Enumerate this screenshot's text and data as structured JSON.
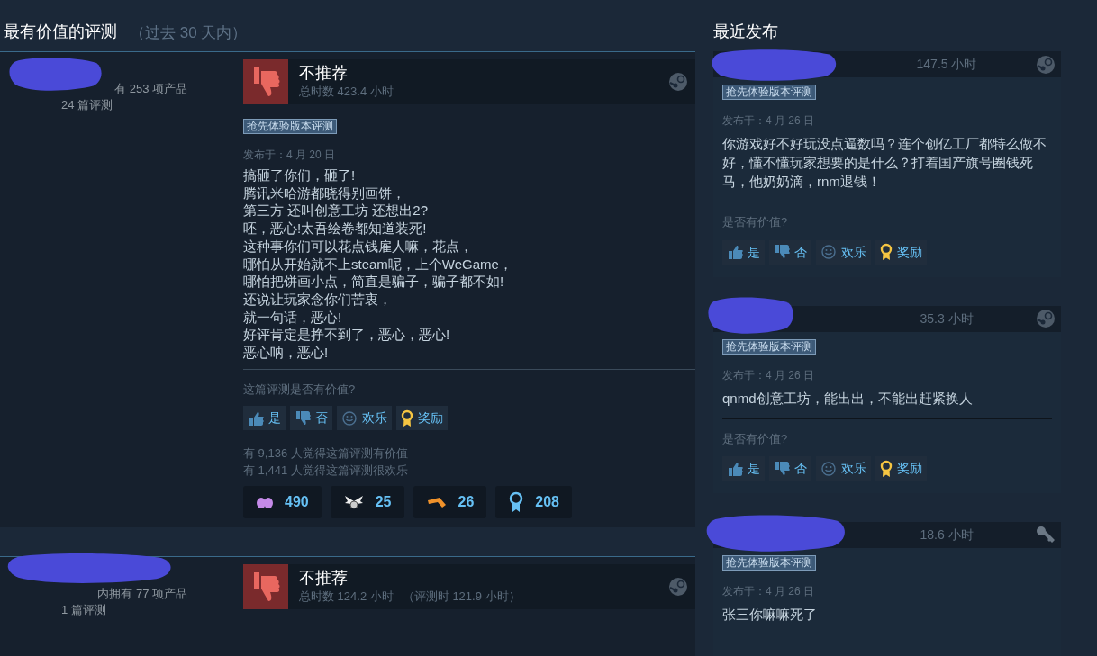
{
  "helpful_section": {
    "title": "最有价值的评测",
    "subtitle": "（过去 30 天内）"
  },
  "helpful_reviews": [
    {
      "author": {
        "products": "有 253 项产品",
        "reviews": "24 篇评测"
      },
      "recommended": false,
      "verdict": "不推荐",
      "hours": "总时数 423.4 小时",
      "kind": "steam",
      "badge": "抢先体验版本评测",
      "posted": "发布于：4 月 20 日",
      "body_lines": [
        "搞砸了你们，砸了!",
        "腾讯米哈游都晓得别画饼，",
        "第三方 还叫创意工坊 还想出2?",
        "呸，恶心!太吾绘卷都知道装死!",
        "这种事你们可以花点钱雇人嘛，花点，",
        "哪怕从开始就不上steam呢，上个WeGame，",
        "哪怕把饼画小点，简直是骗子，骗子都不如!",
        "还说让玩家念你们苦衷，",
        "就一句话，恶心!",
        "好评肯定是挣不到了，恶心，恶心!",
        "恶心呐，恶心!"
      ],
      "question": "这篇评测是否有价值?",
      "buttons": [
        {
          "kind": "yes",
          "label": "是"
        },
        {
          "kind": "no",
          "label": "否"
        },
        {
          "kind": "funny",
          "label": "欢乐"
        },
        {
          "kind": "award",
          "label": "奖励"
        }
      ],
      "stats": [
        "有 9,136 人觉得这篇评测有价值",
        "有 1,441 人觉得这篇评测很欢乐"
      ],
      "awards": [
        {
          "kind": "hearts",
          "count": "490"
        },
        {
          "kind": "wings",
          "count": "25"
        },
        {
          "kind": "boomerang",
          "count": "26"
        },
        {
          "kind": "ribbon",
          "count": "208"
        }
      ]
    },
    {
      "author": {
        "products": "内拥有 77 项产品",
        "reviews": "1 篇评测"
      },
      "recommended": false,
      "verdict": "不推荐",
      "hours": "总时数 124.2 小时",
      "hours_at_review": "（评测时 121.9 小时）",
      "kind": "steam"
    }
  ],
  "recent_section": {
    "title": "最近发布"
  },
  "recent_reviews": [
    {
      "hours": "147.5 小时",
      "kind": "steam",
      "badge": "抢先体验版本评测",
      "posted": "发布于：4 月 26 日",
      "body": "你游戏好不好玩没点逼数吗？连个创亿工厂都特么做不好，懂不懂玩家想要的是什么？打着国产旗号圈钱死马，他奶奶滴，rnm退钱！",
      "question": "是否有价值?",
      "buttons": [
        {
          "kind": "yes",
          "label": "是"
        },
        {
          "kind": "no",
          "label": "否"
        },
        {
          "kind": "funny",
          "label": "欢乐"
        },
        {
          "kind": "award",
          "label": "奖励"
        }
      ]
    },
    {
      "hours": "35.3 小时",
      "kind": "steam",
      "badge": "抢先体验版本评测",
      "posted": "发布于：4 月 26 日",
      "body": "qnmd创意工坊，能出出，不能出赶紧换人",
      "question": "是否有价值?",
      "buttons": [
        {
          "kind": "yes",
          "label": "是"
        },
        {
          "kind": "no",
          "label": "否"
        },
        {
          "kind": "funny",
          "label": "欢乐"
        },
        {
          "kind": "award",
          "label": "奖励"
        }
      ]
    },
    {
      "hours": "18.6 小时",
      "kind": "key",
      "badge": "抢先体验版本评测",
      "posted": "发布于：4 月 26 日",
      "body": "张三你嘛嘛死了"
    }
  ]
}
